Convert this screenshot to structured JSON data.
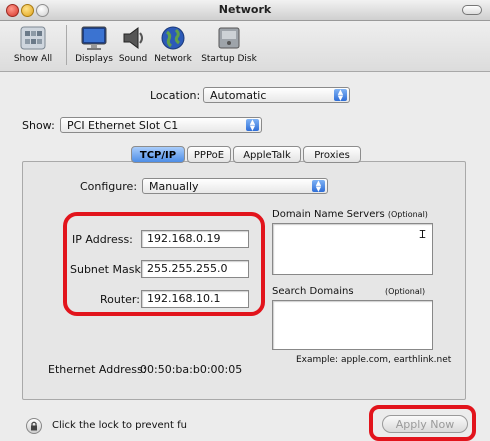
{
  "window": {
    "title": "Network"
  },
  "toolbar": {
    "items": [
      {
        "label": "Show All",
        "icon": "grid-icon"
      },
      {
        "label": "Displays",
        "icon": "display-icon"
      },
      {
        "label": "Sound",
        "icon": "speaker-icon"
      },
      {
        "label": "Network",
        "icon": "globe-icon"
      },
      {
        "label": "Startup Disk",
        "icon": "disk-icon"
      }
    ]
  },
  "location": {
    "label": "Location:",
    "value": "Automatic"
  },
  "show": {
    "label": "Show:",
    "value": "PCI Ethernet Slot C1"
  },
  "tabs": [
    "TCP/IP",
    "PPPoE",
    "AppleTalk",
    "Proxies"
  ],
  "active_tab": "TCP/IP",
  "configure": {
    "label": "Configure:",
    "value": "Manually"
  },
  "ip": {
    "address_label": "IP Address:",
    "address": "192.168.0.19",
    "subnet_label": "Subnet Mask:",
    "subnet": "255.255.255.0",
    "router_label": "Router:",
    "router": "192.168.10.1"
  },
  "dns": {
    "label": "Domain Name Servers",
    "optional": "(Optional)"
  },
  "search_domains": {
    "label": "Search Domains",
    "optional": "(Optional)",
    "example": "Example: apple.com, earthlink.net"
  },
  "ethernet": {
    "label": "Ethernet Address:",
    "value": "00:50:ba:b0:00:05"
  },
  "footer": {
    "lock_text": "Click the lock to prevent fu",
    "apply_label": "Apply Now"
  },
  "colors": {
    "highlight": "#e2141c",
    "tab_active": "#4d8de6"
  }
}
